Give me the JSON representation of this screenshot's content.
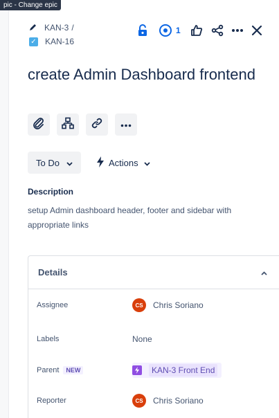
{
  "tooltip": "pic - Change epic",
  "breadcrumb": {
    "parent_key": "KAN-3",
    "separator": "/",
    "issue_key": "KAN-16"
  },
  "header": {
    "watch_count": "1"
  },
  "issue": {
    "title": "create Admin Dashboard frontend"
  },
  "status": {
    "label": "To Do",
    "actions_label": "Actions"
  },
  "description": {
    "label": "Description",
    "text": "setup Admin dashboard header, footer and sidebar with appropriate links"
  },
  "details": {
    "title": "Details",
    "assignee_label": "Assignee",
    "assignee_initials": "CS",
    "assignee_name": "Chris Soriano",
    "labels_label": "Labels",
    "labels_value": "None",
    "parent_label": "Parent",
    "parent_badge": "NEW",
    "parent_value": "KAN-3 Front End",
    "reporter_label": "Reporter",
    "reporter_initials": "CS",
    "reporter_name": "Chris Soriano"
  },
  "colors": {
    "accent": "#0c66e4",
    "lock": "#e2b203",
    "avatar": "#d93f0b",
    "epic": "#904ee2"
  }
}
